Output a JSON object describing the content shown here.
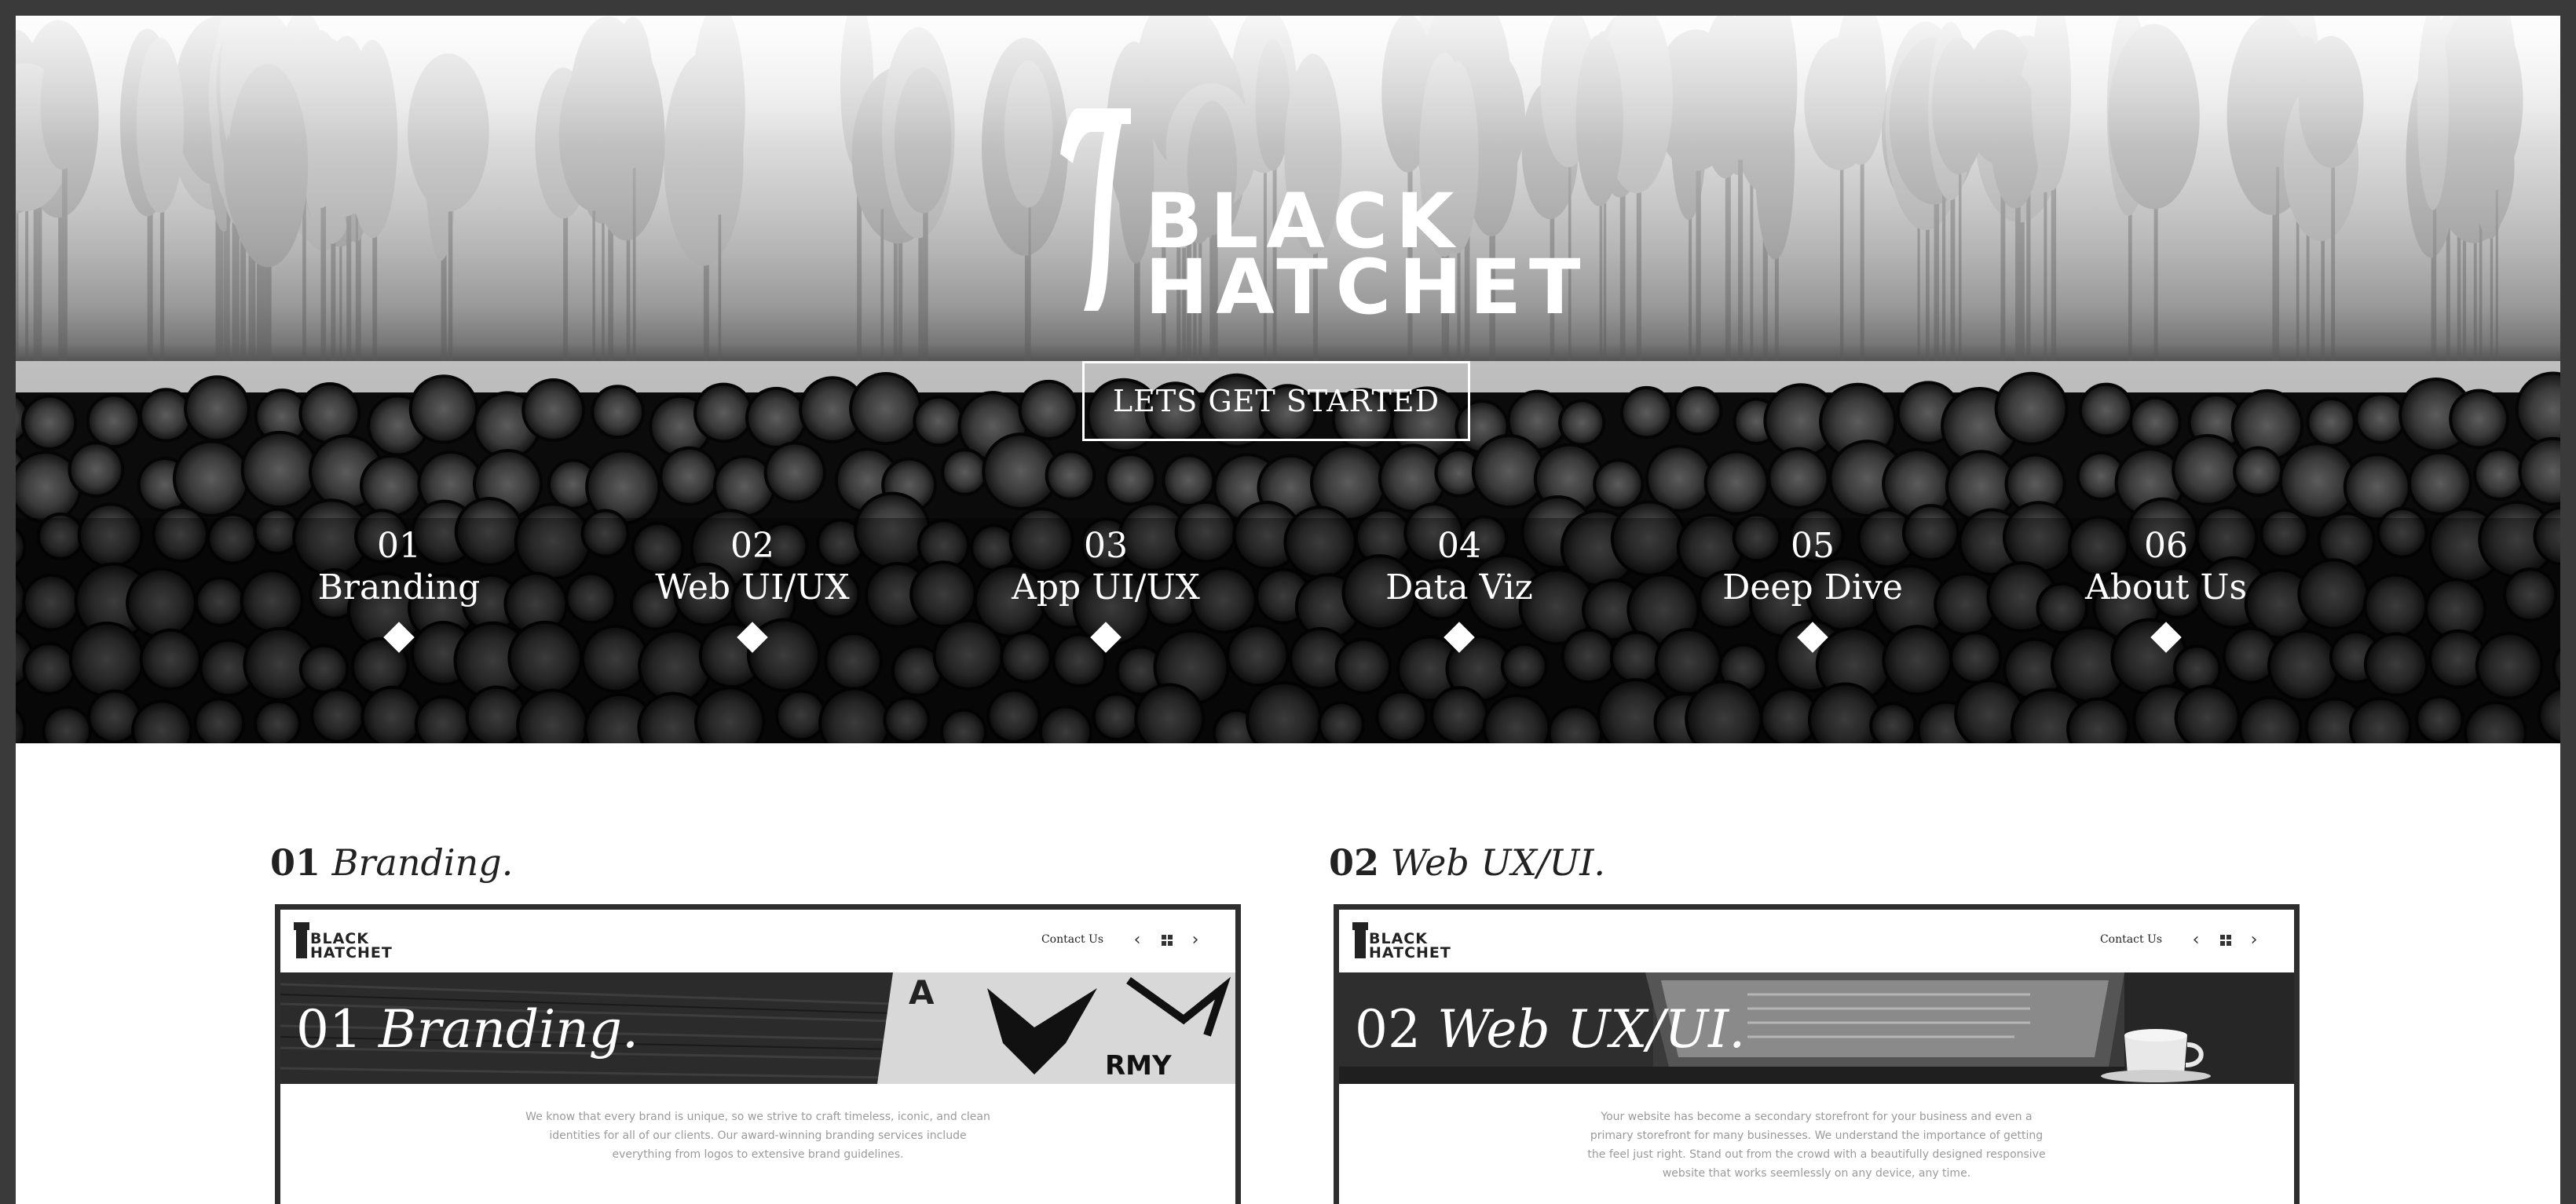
{
  "hero": {
    "logo_line1": "BLACK",
    "logo_line2": "HATCHET",
    "cta_label": "LETS GET STARTED",
    "nav": [
      {
        "num": "01",
        "label": "Branding"
      },
      {
        "num": "02",
        "label": "Web UI/UX"
      },
      {
        "num": "03",
        "label": "App UI/UX"
      },
      {
        "num": "04",
        "label": "Data Viz"
      },
      {
        "num": "05",
        "label": "Deep Dive"
      },
      {
        "num": "06",
        "label": "About Us"
      }
    ]
  },
  "sections": [
    {
      "num": "01",
      "name": "Branding.",
      "card": {
        "logo_line1": "BLACK",
        "logo_line2": "HATCHET",
        "contact": "Contact Us",
        "banner_num": "01",
        "banner_name": "Branding.",
        "desc_lines": [
          "We know that every brand is unique, so we strive to craft timeless, iconic, and clean",
          "identities for all of our clients. Our award-winning branding services include",
          "everything from logos to extensive brand guidelines."
        ]
      }
    },
    {
      "num": "02",
      "name": "Web UX/UI.",
      "card": {
        "logo_line1": "BLACK",
        "logo_line2": "HATCHET",
        "contact": "Contact Us",
        "banner_num": "02",
        "banner_name": "Web UX/UI.",
        "desc_lines": [
          "Your website has become a secondary storefront for your business and even a",
          "primary storefront for many businesses. We understand the importance of getting",
          "the feel just right. Stand out from the crowd with a beautifully designed responsive",
          "website that works seemlessly on any device, any time."
        ]
      }
    }
  ],
  "colors": {
    "frame": "#3a3a3a",
    "hero_dark": "#0a0a0a",
    "card_border": "#2e2e2e",
    "desc_text": "#9a9a9a"
  },
  "icons": [
    "hatchet-logo-icon",
    "chevron-left-icon",
    "grid-icon",
    "chevron-right-icon",
    "diamond-icon"
  ]
}
